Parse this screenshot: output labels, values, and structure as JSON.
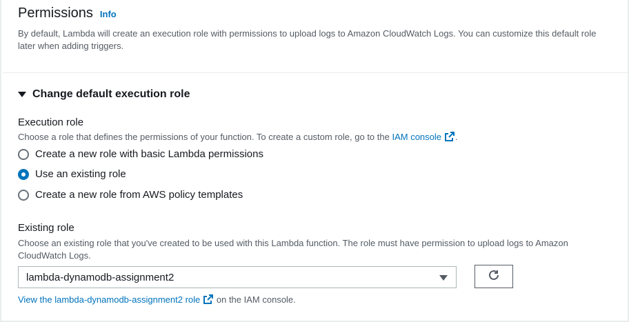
{
  "permissions": {
    "title": "Permissions",
    "info_label": "Info",
    "description": "By default, Lambda will create an execution role with permissions to upload logs to Amazon CloudWatch Logs. You can customize this default role later when adding triggers."
  },
  "expander": {
    "label": "Change default execution role",
    "expanded": true
  },
  "execution_role": {
    "label": "Execution role",
    "description_prefix": "Choose a role that defines the permissions of your function. To create a custom role, go to the",
    "iam_console_link": "IAM console",
    "description_suffix": ".",
    "options": [
      {
        "label": "Create a new role with basic Lambda permissions",
        "selected": false
      },
      {
        "label": "Use an existing role",
        "selected": true
      },
      {
        "label": "Create a new role from AWS policy templates",
        "selected": false
      }
    ]
  },
  "existing_role": {
    "label": "Existing role",
    "description": "Choose an existing role that you've created to be used with this Lambda function. The role must have permission to upload logs to Amazon CloudWatch Logs.",
    "selected_value": "lambda-dynamodb-assignment2",
    "view_link": "View the lambda-dynamodb-assignment2 role",
    "view_suffix": "on the IAM console."
  },
  "colors": {
    "accent": "#0073bb",
    "text": "#16191f",
    "secondary_text": "#545b64",
    "border": "#aab7b8"
  },
  "icons": [
    "external-link-icon",
    "refresh-icon",
    "caret-down-icon"
  ]
}
